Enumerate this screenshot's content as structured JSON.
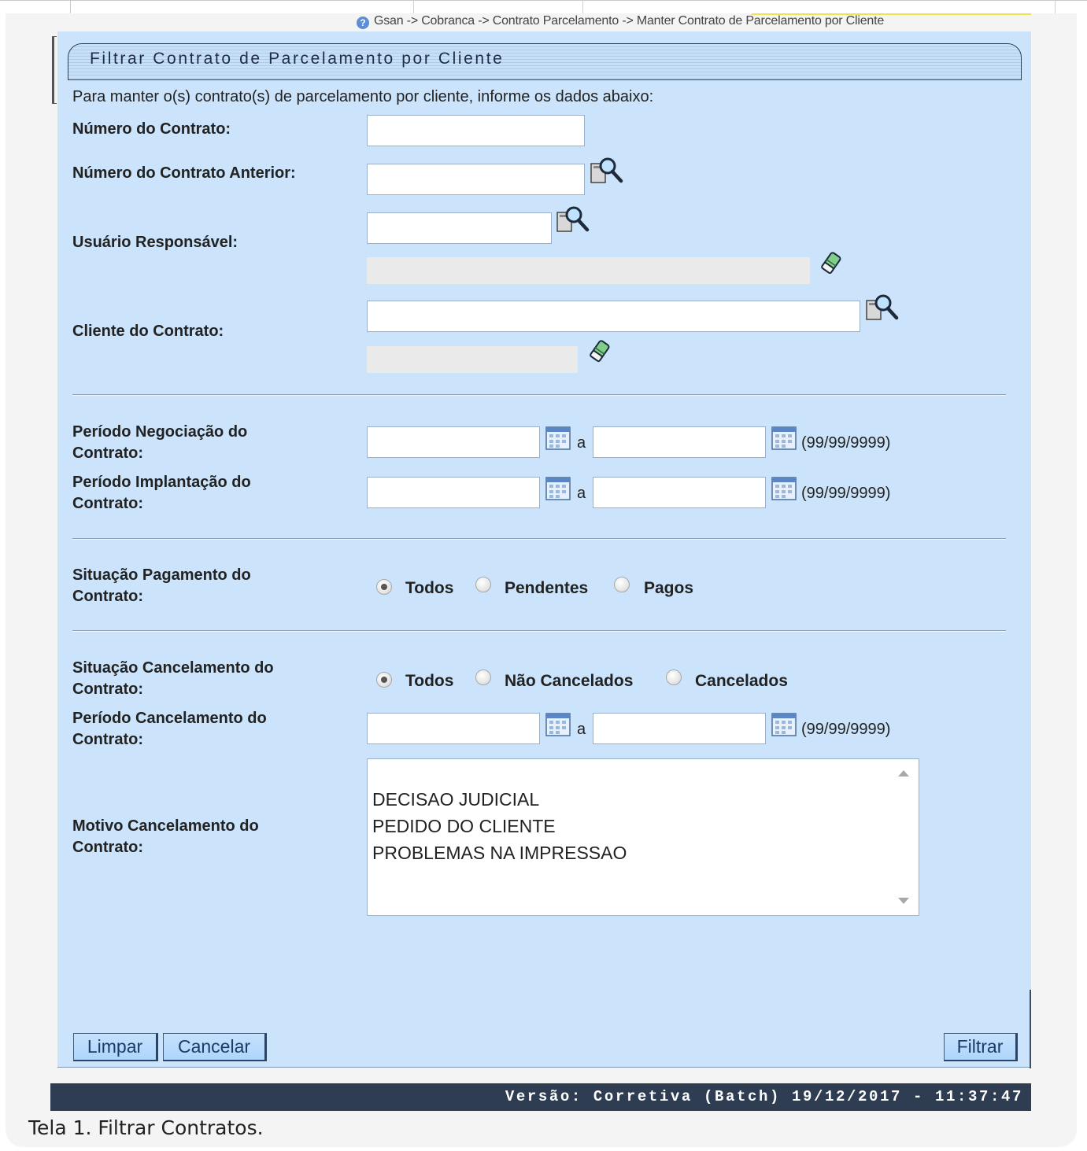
{
  "breadcrumb": "Gsan -> Cobranca -> Contrato Parcelamento -> Manter Contrato de Parcelamento por Cliente",
  "header": {
    "title": "Filtrar Contrato de Parcelamento por Cliente"
  },
  "intro": "Para manter o(s) contrato(s) de parcelamento por cliente, informe os dados abaixo:",
  "fields": {
    "numero_contrato": {
      "label": "Número do Contrato:",
      "value": ""
    },
    "numero_contrato_anterior": {
      "label": "Número do Contrato Anterior:",
      "value": ""
    },
    "usuario_responsavel": {
      "label": "Usuário Responsável:",
      "value": "",
      "description": ""
    },
    "cliente_contrato": {
      "label": "Cliente do Contrato:",
      "value": "",
      "description": ""
    },
    "periodo_negociacao": {
      "label_line1": "Período Negociação do",
      "label_line2": "Contrato:",
      "start": "",
      "end": "",
      "separator": "a",
      "format": "(99/99/9999)"
    },
    "periodo_implantacao": {
      "label_line1": "Período Implantação do",
      "label_line2": "Contrato:",
      "start": "",
      "end": "",
      "separator": "a",
      "format": "(99/99/9999)"
    },
    "situacao_pagamento": {
      "label_line1": "Situação Pagamento do",
      "label_line2": "Contrato:",
      "options": [
        "Todos",
        "Pendentes",
        "Pagos"
      ],
      "selected": "Todos"
    },
    "situacao_cancelamento": {
      "label_line1": "Situação Cancelamento do",
      "label_line2": "Contrato:",
      "options": [
        "Todos",
        "Não Cancelados",
        "Cancelados"
      ],
      "selected": "Todos"
    },
    "periodo_cancelamento": {
      "label_line1": "Período Cancelamento do",
      "label_line2": "Contrato:",
      "start": "",
      "end": "",
      "separator": "a",
      "format": "(99/99/9999)"
    },
    "motivo_cancelamento": {
      "label_line1": "Motivo Cancelamento do",
      "label_line2": "Contrato:",
      "options": [
        "DECISAO JUDICIAL",
        "PEDIDO DO CLIENTE",
        "PROBLEMAS NA IMPRESSAO"
      ]
    }
  },
  "buttons": {
    "limpar": "Limpar",
    "cancelar": "Cancelar",
    "filtrar": "Filtrar"
  },
  "footer": {
    "version": "Versão: Corretiva (Batch) 19/12/2017 - 11:37:47"
  },
  "caption": "Tela 1. Filtrar Contratos.",
  "icons": {
    "search": "magnifier-icon",
    "clear": "eraser-icon",
    "calendar": "calendar-icon",
    "help": "help-icon"
  },
  "colors": {
    "panel": "#cbe4fc",
    "footer": "#2e3d52",
    "button": "#aed5fb",
    "button_text": "#1d3b66"
  }
}
